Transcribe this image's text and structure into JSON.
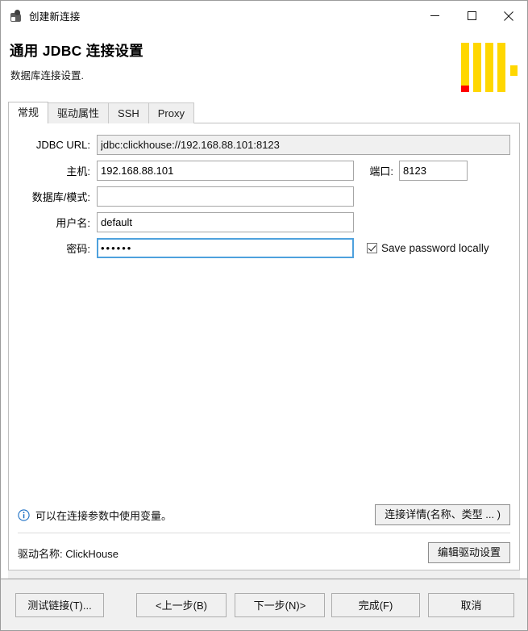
{
  "window": {
    "title": "创建新连接",
    "icon": "dbeaver-app-icon",
    "controls": {
      "minimize": "minimize-icon",
      "maximize": "maximize-icon",
      "close": "close-icon"
    }
  },
  "header": {
    "title": "通用 JDBC 连接设置",
    "subtitle": "数据库连接设置.",
    "logo": "dbeaver-logo",
    "logo_colors": {
      "bars": "#ffd700",
      "accent": "#ff0000"
    }
  },
  "tabs": [
    {
      "label": "常规",
      "active": true
    },
    {
      "label": "驱动属性",
      "active": false
    },
    {
      "label": "SSH",
      "active": false
    },
    {
      "label": "Proxy",
      "active": false
    }
  ],
  "form": {
    "jdbc_url": {
      "label": "JDBC URL:",
      "value": "jdbc:clickhouse://192.168.88.101:8123",
      "readonly": true
    },
    "host": {
      "label": "主机:",
      "value": "192.168.88.101"
    },
    "port": {
      "label": "端口:",
      "value": "8123"
    },
    "database": {
      "label": "数据库/模式:",
      "value": "",
      "placeholder": ""
    },
    "username": {
      "label": "用户名:",
      "value": "default"
    },
    "password": {
      "label": "密码:",
      "value": "••••••",
      "focused": true
    },
    "save_password": {
      "label": "Save password locally",
      "checked": true
    }
  },
  "info": {
    "icon": "info-circle-icon",
    "text": "可以在连接参数中使用变量。",
    "details_button": "连接详情(名称、类型 ... )"
  },
  "driver": {
    "label": "驱动名称: ClickHouse",
    "edit_button": "编辑驱动设置"
  },
  "footer": {
    "test_button": "测试链接(T)...",
    "back_button": "<上一步(B)",
    "next_button": "下一步(N)>",
    "finish_button": "完成(F)",
    "cancel_button": "取消"
  },
  "colors": {
    "accent": "#0078d7",
    "focus_border": "#4ea1dd",
    "window_bg": "#f0f0f0",
    "panel_bg": "#ffffff"
  }
}
